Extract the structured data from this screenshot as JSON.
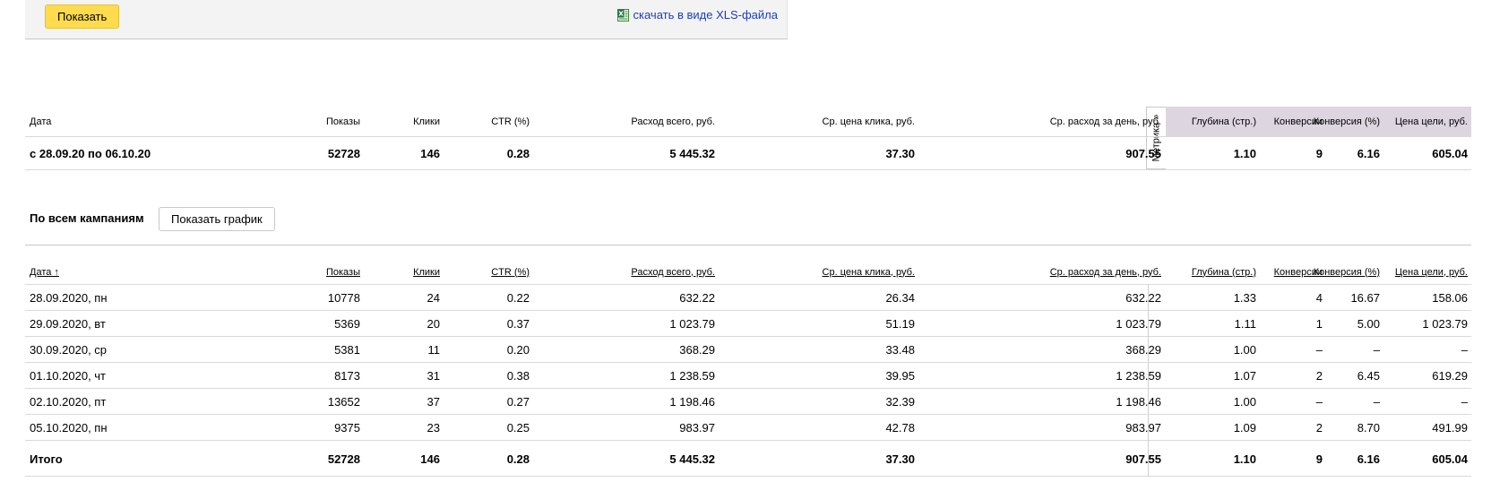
{
  "toolbar": {
    "show_label": "Показать",
    "xls_label": "скачать в виде XLS-файла"
  },
  "summary": {
    "metrika_tab_label": "Метрика »",
    "headers": [
      "Дата",
      "Показы",
      "Клики",
      "CTR (%)",
      "Расход всего, руб.",
      "Ср. цена клика, руб.",
      "Ср. расход за день, руб.",
      "Глубина (стр.)",
      "Конверсии",
      "Конверсия (%)",
      "Цена цели, руб."
    ],
    "row": [
      "с 28.09.20 по 06.10.20",
      "52728",
      "146",
      "0.28",
      "5 445.32",
      "37.30",
      "907.55",
      "1.10",
      "9",
      "6.16",
      "605.04"
    ]
  },
  "campaigns": {
    "title": "По всем кампаниям",
    "graph_button_label": "Показать график",
    "headers": [
      "Дата ↑",
      "Показы",
      "Клики",
      "CTR (%)",
      "Расход всего, руб.",
      "Ср. цена клика, руб.",
      "Ср. расход за день, руб.",
      "Глубина (стр.)",
      "Конверсии",
      "Конверсия (%)",
      "Цена цели, руб."
    ],
    "rows": [
      [
        "28.09.2020, пн",
        "10778",
        "24",
        "0.22",
        "632.22",
        "26.34",
        "632.22",
        "1.33",
        "4",
        "16.67",
        "158.06"
      ],
      [
        "29.09.2020, вт",
        "5369",
        "20",
        "0.37",
        "1 023.79",
        "51.19",
        "1 023.79",
        "1.11",
        "1",
        "5.00",
        "1 023.79"
      ],
      [
        "30.09.2020, ср",
        "5381",
        "11",
        "0.20",
        "368.29",
        "33.48",
        "368.29",
        "1.00",
        "–",
        "–",
        "–"
      ],
      [
        "01.10.2020, чт",
        "8173",
        "31",
        "0.38",
        "1 238.59",
        "39.95",
        "1 238.59",
        "1.07",
        "2",
        "6.45",
        "619.29"
      ],
      [
        "02.10.2020, пт",
        "13652",
        "37",
        "0.27",
        "1 198.46",
        "32.39",
        "1 198.46",
        "1.00",
        "–",
        "–",
        "–"
      ],
      [
        "05.10.2020, пн",
        "9375",
        "23",
        "0.25",
        "983.97",
        "42.78",
        "983.97",
        "1.09",
        "2",
        "8.70",
        "491.99"
      ]
    ],
    "total": [
      "Итого",
      "52728",
      "146",
      "0.28",
      "5 445.32",
      "37.30",
      "907.55",
      "1.10",
      "9",
      "6.16",
      "605.04"
    ]
  },
  "colors": {
    "accent_button": "#ffdb4d",
    "link": "#1a3dc1",
    "metrika_header_bg": "#ddd6e0"
  }
}
